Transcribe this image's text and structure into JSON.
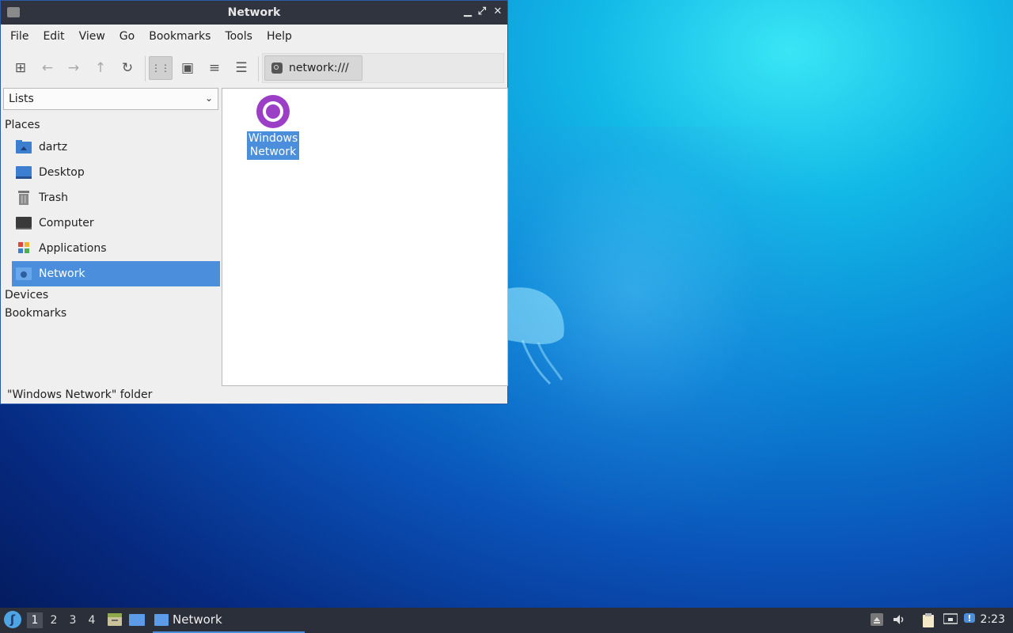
{
  "window": {
    "title": "Network",
    "controls": {
      "minimize": "▁",
      "maximize": "⤢",
      "close": "✕"
    }
  },
  "menu": [
    "File",
    "Edit",
    "View",
    "Go",
    "Bookmarks",
    "Tools",
    "Help"
  ],
  "toolbar": {
    "buttons": [
      {
        "name": "new-tab",
        "icon": "new-tab-icon",
        "glyph": "⊞"
      },
      {
        "name": "back",
        "icon": "arrow-left-icon",
        "glyph": "←"
      },
      {
        "name": "forward",
        "icon": "arrow-right-icon",
        "glyph": "→"
      },
      {
        "name": "up",
        "icon": "arrow-up-icon",
        "glyph": "↑"
      },
      {
        "name": "reload",
        "icon": "reload-icon",
        "glyph": "↻"
      },
      {
        "name": "icon-view",
        "icon": "grid-icon",
        "glyph": "⋮⋮"
      },
      {
        "name": "thumbnail-view",
        "icon": "image-icon",
        "glyph": "▣"
      },
      {
        "name": "compact-view",
        "icon": "list-icon",
        "glyph": "≡"
      },
      {
        "name": "detailed-view",
        "icon": "detailed-list-icon",
        "glyph": "☰"
      }
    ],
    "location": "network:///"
  },
  "sidebar": {
    "dropdown": "Lists",
    "places_header": "Places",
    "items": [
      {
        "label": "dartz",
        "icon": "home-folder-icon"
      },
      {
        "label": "Desktop",
        "icon": "desktop-icon"
      },
      {
        "label": "Trash",
        "icon": "trash-icon"
      },
      {
        "label": "Computer",
        "icon": "computer-icon"
      },
      {
        "label": "Applications",
        "icon": "applications-icon"
      },
      {
        "label": "Network",
        "icon": "network-icon"
      }
    ],
    "devices_header": "Devices",
    "bookmarks_header": "Bookmarks"
  },
  "content": {
    "items": [
      {
        "label_line1": "Windows",
        "label_line2": "Network",
        "icon": "windows-network-icon"
      }
    ]
  },
  "status": "\"Windows Network\" folder",
  "taskbar": {
    "desktops": [
      "1",
      "2",
      "3",
      "4"
    ],
    "task_label": "Network",
    "clock": "2:23"
  }
}
